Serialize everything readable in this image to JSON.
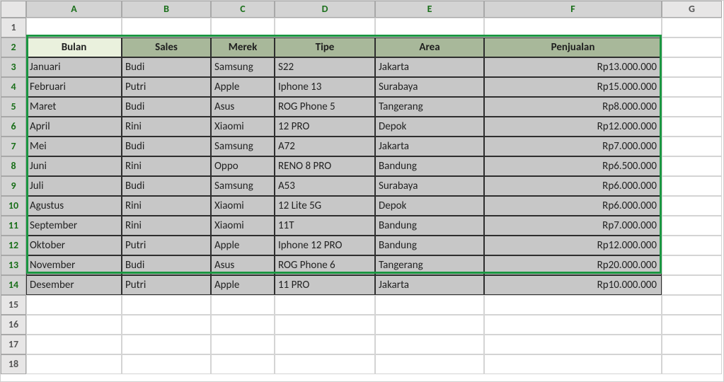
{
  "columns": [
    "A",
    "B",
    "C",
    "D",
    "E",
    "F",
    "G"
  ],
  "row_numbers": [
    1,
    2,
    3,
    4,
    5,
    6,
    7,
    8,
    9,
    10,
    11,
    12,
    13,
    14,
    15,
    16,
    17,
    18
  ],
  "table": {
    "headers": [
      "Bulan",
      "Sales",
      "Merek",
      "Tipe",
      "Area",
      "Penjualan"
    ],
    "rows": [
      {
        "bulan": "Januari",
        "sales": "Budi",
        "merek": "Samsung",
        "tipe": "S22",
        "area": "Jakarta",
        "penjualan": "Rp13.000.000"
      },
      {
        "bulan": "Februari",
        "sales": "Putri",
        "merek": "Apple",
        "tipe": "Iphone 13",
        "area": "Surabaya",
        "penjualan": "Rp15.000.000"
      },
      {
        "bulan": "Maret",
        "sales": "Budi",
        "merek": "Asus",
        "tipe": "ROG Phone 5",
        "area": "Tangerang",
        "penjualan": "Rp8.000.000"
      },
      {
        "bulan": "April",
        "sales": "Rini",
        "merek": "Xiaomi",
        "tipe": "12 PRO",
        "area": "Depok",
        "penjualan": "Rp12.000.000"
      },
      {
        "bulan": "Mei",
        "sales": "Budi",
        "merek": "Samsung",
        "tipe": "A72",
        "area": "Jakarta",
        "penjualan": "Rp7.000.000"
      },
      {
        "bulan": "Juni",
        "sales": "Rini",
        "merek": "Oppo",
        "tipe": "RENO 8 PRO",
        "area": "Bandung",
        "penjualan": "Rp6.500.000"
      },
      {
        "bulan": "Juli",
        "sales": "Budi",
        "merek": "Samsung",
        "tipe": "A53",
        "area": "Surabaya",
        "penjualan": "Rp6.000.000"
      },
      {
        "bulan": "Agustus",
        "sales": "Rini",
        "merek": "Xiaomi",
        "tipe": "12 Lite 5G",
        "area": "Depok",
        "penjualan": "Rp6.000.000"
      },
      {
        "bulan": "September",
        "sales": "Rini",
        "merek": "Xiaomi",
        "tipe": "11T",
        "area": "Bandung",
        "penjualan": "Rp7.000.000"
      },
      {
        "bulan": "Oktober",
        "sales": "Putri",
        "merek": "Apple",
        "tipe": "Iphone 12 PRO",
        "area": "Bandung",
        "penjualan": "Rp12.000.000"
      },
      {
        "bulan": "November",
        "sales": "Budi",
        "merek": "Asus",
        "tipe": "ROG Phone 6",
        "area": "Tangerang",
        "penjualan": "Rp20.000.000"
      },
      {
        "bulan": "Desember",
        "sales": "Putri",
        "merek": "Apple",
        "tipe": "11 PRO",
        "area": "Jakarta",
        "penjualan": "Rp10.000.000"
      }
    ]
  },
  "selection": {
    "top_row": 2,
    "bottom_row": 14,
    "left_col": "A",
    "right_col": "F"
  }
}
